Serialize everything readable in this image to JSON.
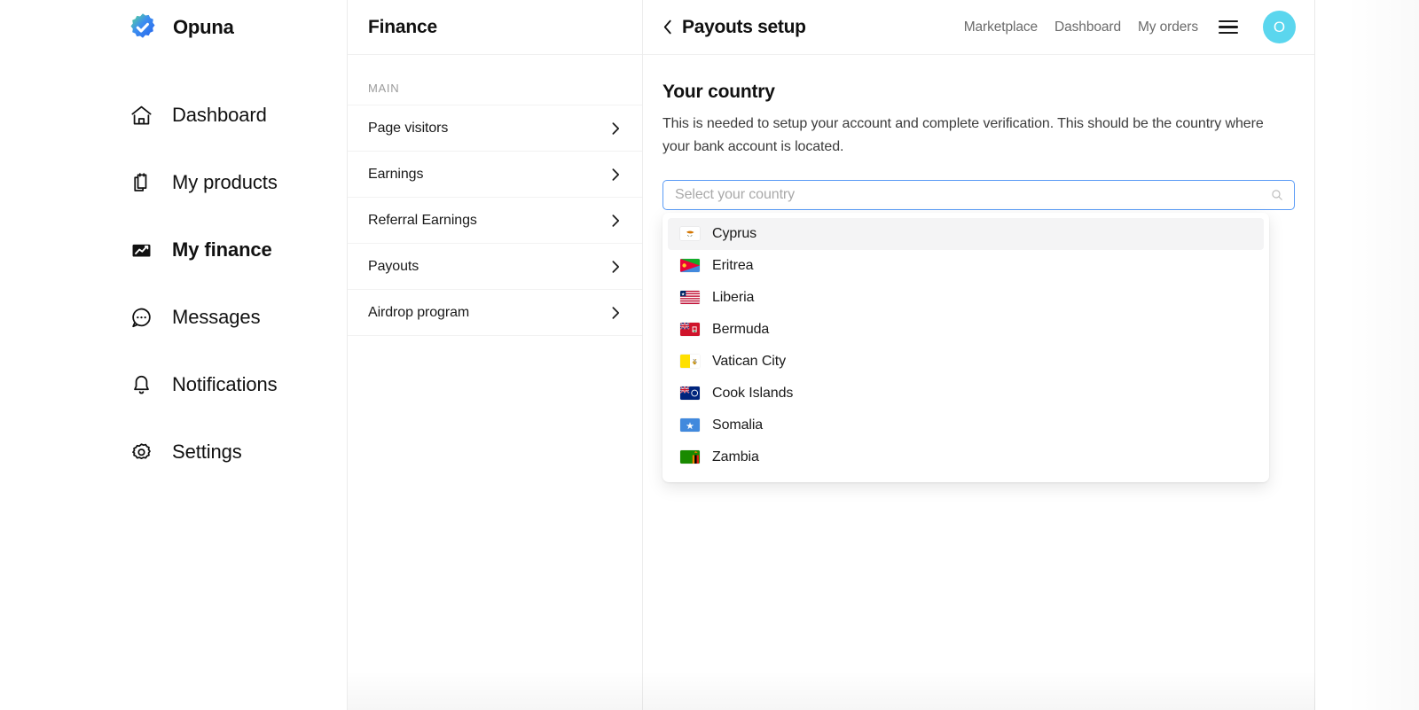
{
  "brand": {
    "name": "Opuna",
    "logo_icon": "verified-badge-icon",
    "gradient_from": "#4ADE80",
    "gradient_to": "#2563EB"
  },
  "sidebar": {
    "items": [
      {
        "label": "Dashboard",
        "icon": "home-icon",
        "active": false
      },
      {
        "label": "My products",
        "icon": "documents-icon",
        "active": false
      },
      {
        "label": "My finance",
        "icon": "chart-line-icon",
        "active": true
      },
      {
        "label": "Messages",
        "icon": "chat-bubble-icon",
        "active": false
      },
      {
        "label": "Notifications",
        "icon": "bell-icon",
        "active": false
      },
      {
        "label": "Settings",
        "icon": "gear-icon",
        "active": false
      }
    ]
  },
  "finance": {
    "title": "Finance",
    "section_label": "MAIN",
    "rows": [
      {
        "label": "Page visitors",
        "icon": "chevron-right-icon"
      },
      {
        "label": "Earnings",
        "icon": "chevron-right-icon"
      },
      {
        "label": "Referral Earnings",
        "icon": "chevron-right-icon"
      },
      {
        "label": "Payouts",
        "icon": "chevron-right-icon"
      },
      {
        "label": "Airdrop program",
        "icon": "chevron-right-icon"
      }
    ]
  },
  "topbar": {
    "back_icon": "chevron-left-icon",
    "title": "Payouts setup",
    "links": [
      {
        "label": "Marketplace"
      },
      {
        "label": "Dashboard"
      },
      {
        "label": "My orders"
      }
    ],
    "menu_icon": "hamburger-icon",
    "avatar_initial": "O",
    "avatar_color": "#5BD6EE"
  },
  "main": {
    "heading": "Your country",
    "description": "This is needed to setup your account and complete verification. This should be the country where your bank account is located.",
    "country_select": {
      "value": "",
      "placeholder": "Select your country",
      "search_icon": "search-icon",
      "focused": true,
      "border_color": "#5a9bf6",
      "options": [
        {
          "name": "Cyprus",
          "code": "CY",
          "highlighted": true
        },
        {
          "name": "Eritrea",
          "code": "ER",
          "highlighted": false
        },
        {
          "name": "Liberia",
          "code": "LR",
          "highlighted": false
        },
        {
          "name": "Bermuda",
          "code": "BM",
          "highlighted": false
        },
        {
          "name": "Vatican City",
          "code": "VA",
          "highlighted": false
        },
        {
          "name": "Cook Islands",
          "code": "CK",
          "highlighted": false
        },
        {
          "name": "Somalia",
          "code": "SO",
          "highlighted": false
        },
        {
          "name": "Zambia",
          "code": "ZM",
          "highlighted": false
        }
      ]
    }
  }
}
